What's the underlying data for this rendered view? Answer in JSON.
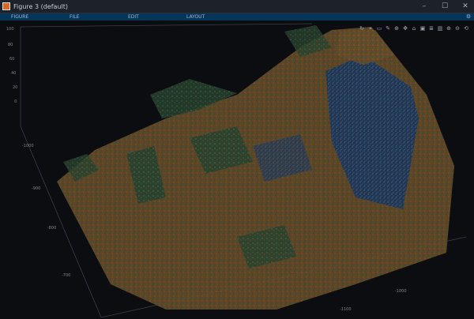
{
  "window": {
    "title": "Figure 3 (default)"
  },
  "menu": {
    "items": [
      "FIGURE",
      "FILE",
      "EDIT",
      "LAYOUT"
    ]
  },
  "toolbar": {
    "icons": [
      "rotate-icon",
      "data-cursor-icon",
      "datatip-icon",
      "brush-icon",
      "zoom-in-icon",
      "pan-icon",
      "home-icon",
      "save-icon",
      "insert-legend-icon",
      "colorbar-icon",
      "zoom-in-icon",
      "zoom-out-icon",
      "restore-view-icon"
    ]
  },
  "axes": {
    "z_ticks": [
      "100",
      "80",
      "60",
      "40",
      "20",
      "0"
    ],
    "y_ticks": [
      "-1000",
      "-900",
      "-800",
      "-700"
    ],
    "x_ticks": [
      "-1100",
      "-1000"
    ]
  },
  "colors": {
    "menu_bg": "#06355a",
    "cloud_orange": "#8a5a2a",
    "cloud_green": "#2f5a3c",
    "cloud_blue": "#2a4a78"
  }
}
